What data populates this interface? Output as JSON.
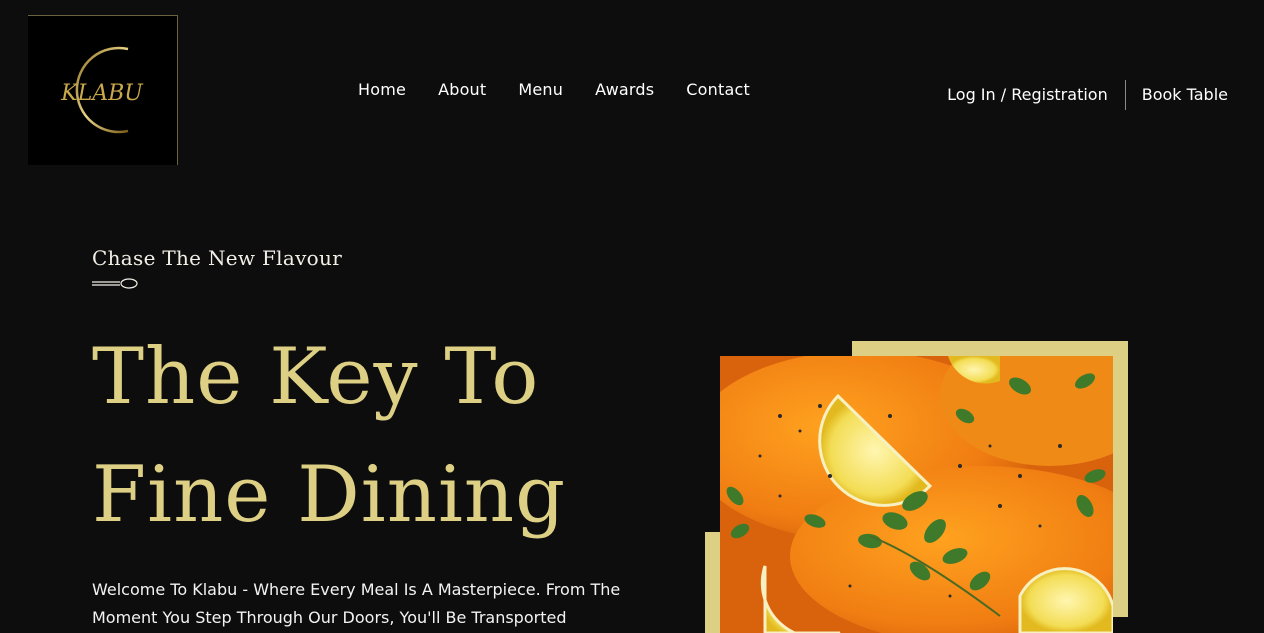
{
  "brand": {
    "logo_text": "KLABU"
  },
  "nav": {
    "items": [
      "Home",
      "About",
      "Menu",
      "Awards",
      "Contact"
    ]
  },
  "account": {
    "login_label": "Log In / Registration",
    "book_label": "Book Table"
  },
  "hero": {
    "kicker": "Chase The New Flavour",
    "headline_line1": "The Key To",
    "headline_line2": "Fine Dining",
    "intro": "Welcome To Klabu - Where Every Meal Is A Masterpiece. From The Moment You Step Through Our Doors, You'll Be Transported"
  },
  "colors": {
    "accent": "#ddd084",
    "background": "#0d0d0e",
    "text": "#ffffff"
  },
  "image": {
    "subject": "salmon-dish-photo"
  }
}
